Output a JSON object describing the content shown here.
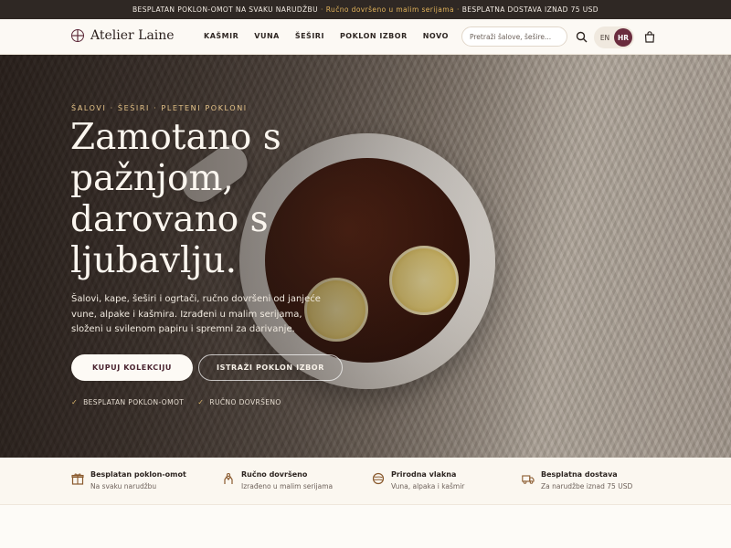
{
  "announcement": {
    "part1": "BESPLATAN POKLON-OMOT NA SVAKU NARUDŽBU",
    "part2": "Ručno dovršeno u malim serijama",
    "part3": "BESPLATNA DOSTAVA IZNAD 75 USD",
    "separator": "·"
  },
  "header": {
    "brand": "Atelier Laine",
    "nav": [
      "KAŠMIR",
      "VUNA",
      "ŠEŠIRI",
      "POKLON IZBOR",
      "NOVO"
    ],
    "search_placeholder": "Pretraži šalove, šešire...",
    "languages": [
      "EN",
      "HR"
    ],
    "active_language": "HR"
  },
  "hero": {
    "eyebrow": "ŠALOVI · ŠEŠIRI · PLETENI POKLONI",
    "headline_lines": [
      "Zamotano s",
      "pažnjom,",
      "darovano s",
      "ljubavlju."
    ],
    "subcopy": "Šalovi, kape, šeširi i ogrtači, ručno dovršeni od janjeće vune, alpake i kašmira. Izrađeni u malim serijama, složeni u svilenom papiru i spremni za darivanje.",
    "cta_primary": "KUPUJ KOLEKCIJU",
    "cta_secondary": "ISTRAŽI POKLON IZBOR",
    "checks": [
      "BESPLATAN POKLON-OMOT",
      "RUČNO DOVRŠENO"
    ]
  },
  "features": [
    {
      "icon": "gift-icon",
      "title": "Besplatan poklon-omot",
      "subtitle": "Na svaku narudžbu"
    },
    {
      "icon": "hand-icon",
      "title": "Ručno dovršeno",
      "subtitle": "Izrađeno u malim serijama"
    },
    {
      "icon": "yarn-icon",
      "title": "Prirodna vlakna",
      "subtitle": "Vuna, alpaka i kašmir"
    },
    {
      "icon": "truck-icon",
      "title": "Besplatna dostava",
      "subtitle": "Za narudžbe iznad 75 USD"
    }
  ],
  "colors": {
    "accent": "#6a2c3e",
    "gold": "#d9b46b",
    "dark": "#2f2824"
  }
}
